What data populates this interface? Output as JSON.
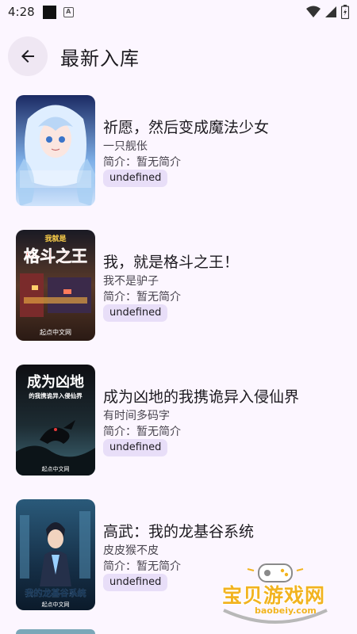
{
  "status_bar": {
    "time": "4:28",
    "a_badge": "A"
  },
  "header": {
    "title": "最新入库",
    "back_icon": "arrow-left-icon"
  },
  "books": [
    {
      "title": "祈愿，然后变成魔法少女",
      "author": "一只舰伥",
      "intro": "简介：暂无简介",
      "tag": "undefined"
    },
    {
      "title": "我，就是格斗之王！",
      "author": "我不是驴子",
      "intro": "简介：暂无简介",
      "tag": "undefined",
      "cover_text": "格斗之王",
      "cover_top": "我就是",
      "cover_bottom": "起点中文网"
    },
    {
      "title": "成为凶地的我携诡异入侵仙界",
      "author": "有时间多码字",
      "intro": "简介：暂无简介",
      "tag": "undefined",
      "cover_text": "成为凶地",
      "cover_sub": "的我携诡异入侵仙界",
      "cover_bottom": "起点中文网"
    },
    {
      "title": "高武：我的龙基谷系统",
      "author": "皮皮猴不皮",
      "intro": "简介：暂无简介",
      "tag": "undefined",
      "cover_text": "我的龙基谷系统",
      "cover_bottom": "起点中文网"
    }
  ],
  "watermark": {
    "name": "宝贝游戏网",
    "url": "baobeiy.com"
  },
  "colors": {
    "background": "#fcf6ff",
    "tag_bg": "#e8def8",
    "back_btn_bg": "#efe7f3",
    "watermark": "#f2b31f"
  }
}
